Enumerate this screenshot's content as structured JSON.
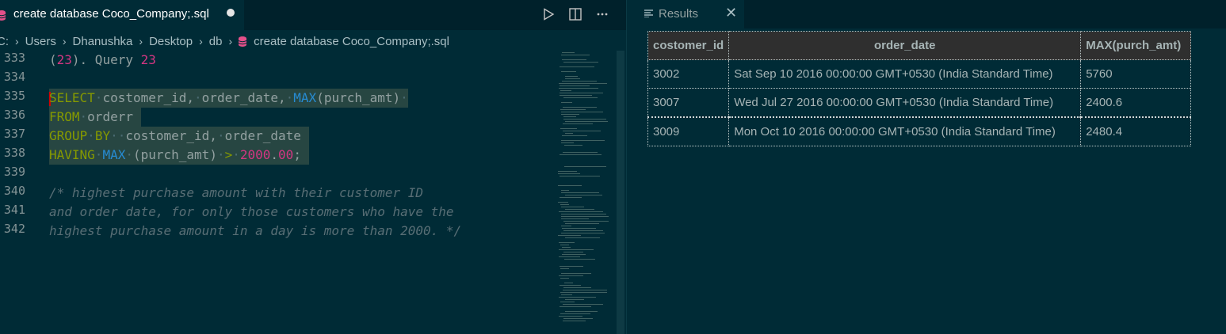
{
  "editor": {
    "tab": {
      "title": "create database Coco_Company;.sql"
    },
    "breadcrumb": [
      "C:",
      "Users",
      "Dhanushka",
      "Desktop",
      "db",
      "create database Coco_Company;.sql"
    ],
    "line_numbers": [
      "333",
      "334",
      "335",
      "336",
      "337",
      "338",
      "339",
      "340",
      "341",
      "342"
    ],
    "code": {
      "l333": {
        "p1": "(",
        "n1": "23",
        "p2": "). Query ",
        "n2": "23"
      },
      "l335": {
        "kw1": "SELECT",
        "t1": "costomer_id,",
        "t2": "order_date,",
        "fn1": "MAX",
        "t3": "(purch_amt)"
      },
      "l336": {
        "kw1": "FROM",
        "t1": "orderr"
      },
      "l337": {
        "kw1": "GROUP",
        "kw2": "BY",
        "t1": "costomer_id,",
        "t2": "order_date"
      },
      "l338": {
        "kw1": "HAVING",
        "fn1": "MAX",
        "t1": "(purch_amt)",
        "op": ">",
        "n1": "2000",
        "dot": ".",
        "n2": "00",
        "end": ";"
      },
      "l340": "/* highest purchase amount with their customer ID",
      "l341": "and order date, for only those customers who have the",
      "l342": "highest purchase amount in a day is more than 2000. */"
    },
    "icons": {
      "run": "play-icon",
      "split": "split-editor-icon",
      "more": "ellipsis-icon",
      "file": "database-icon"
    }
  },
  "results": {
    "tab": {
      "title": "Results"
    },
    "columns": [
      "costomer_id",
      "order_date",
      "MAX(purch_amt)"
    ],
    "rows": [
      [
        "3002",
        "Sat Sep 10 2016 00:00:00 GMT+0530 (India Standard Time)",
        "5760"
      ],
      [
        "3007",
        "Wed Jul 27 2016 00:00:00 GMT+0530 (India Standard Time)",
        "2400.6"
      ],
      [
        "3009",
        "Mon Oct 10 2016 00:00:00 GMT+0530 (India Standard Time)",
        "2480.4"
      ]
    ]
  },
  "colors": {
    "background": "#002b36",
    "keyword": "#859900",
    "function": "#268bd2",
    "number": "#d33682",
    "comment": "#586e75",
    "db_icon": "#e4508a"
  }
}
